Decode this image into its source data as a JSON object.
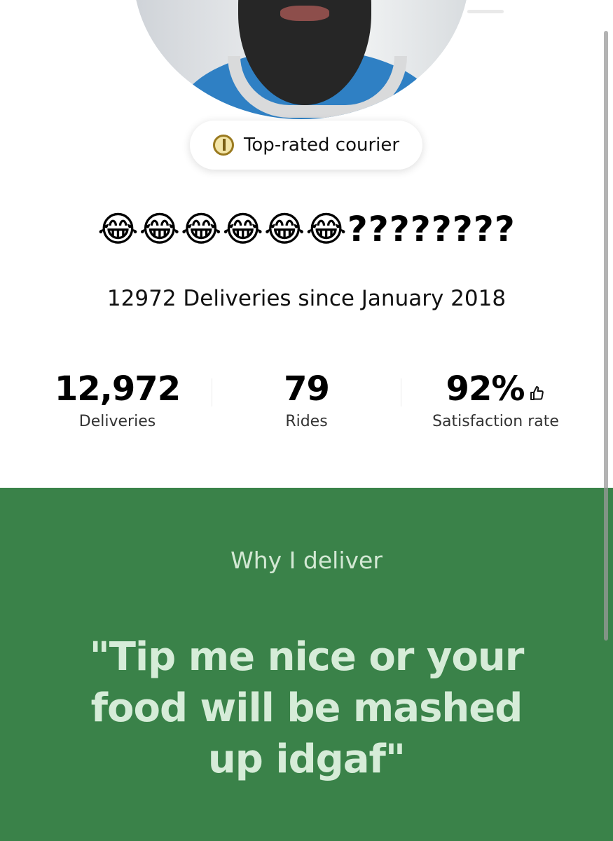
{
  "profile": {
    "badge_label": "Top-rated courier",
    "badge_icon": "rating-badge-icon",
    "name": "😂😂😂😂😂😂????????",
    "deliveries_since": "12972 Deliveries since January 2018"
  },
  "stats": [
    {
      "value": "12,972",
      "label": "Deliveries"
    },
    {
      "value": "79",
      "label": "Rides"
    },
    {
      "value": "92%",
      "label": "Satisfaction rate",
      "icon": "thumbs-up-icon"
    }
  ],
  "why_section": {
    "heading": "Why I deliver",
    "quote": "\"Tip me nice or your food will be mashed up idgaf\""
  },
  "colors": {
    "accent_green": "#3a8249",
    "quote_text": "#d6ecd8",
    "badge_gold": "#9a7a1f"
  }
}
